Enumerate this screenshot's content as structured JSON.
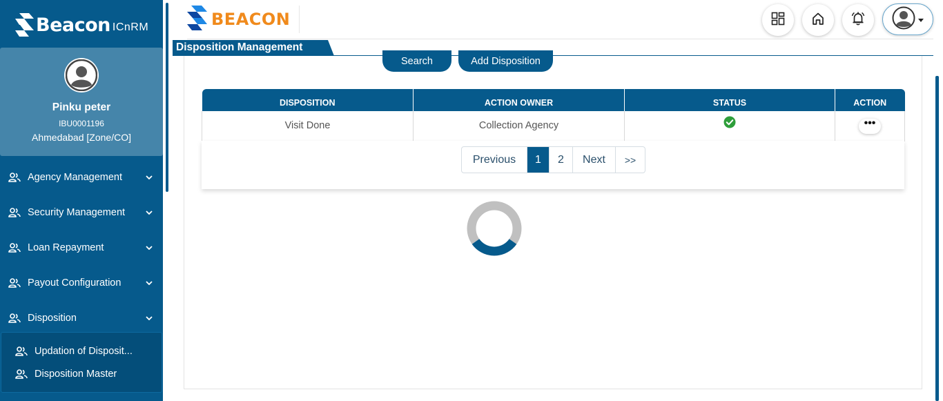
{
  "sidebar": {
    "brand_name": "Beacon",
    "brand_sub": "ICnRM",
    "user": {
      "name": "Pinku peter",
      "id": "IBU0001196",
      "location": "Ahmedabad [Zone/CO]"
    },
    "nav_items": [
      {
        "label": "Agency Management",
        "icon": "users-icon",
        "expandable": true
      },
      {
        "label": "Security Management",
        "icon": "users-icon",
        "expandable": true
      },
      {
        "label": "Loan Repayment",
        "icon": "users-icon",
        "expandable": true
      },
      {
        "label": "Payout Configuration",
        "icon": "users-icon",
        "expandable": true
      },
      {
        "label": "Disposition",
        "icon": "users-icon",
        "expandable": true,
        "expanded": true
      }
    ],
    "sub_items": [
      {
        "label": "Updation of Disposit..."
      },
      {
        "label": "Disposition Master"
      }
    ]
  },
  "header": {
    "logo_text": "BEACON",
    "icons": [
      "dashboard-icon",
      "home-icon",
      "bell-icon",
      "user-avatar-icon"
    ]
  },
  "page": {
    "title": "Disposition Management",
    "search_label": "Search",
    "add_label": "Add Disposition"
  },
  "table": {
    "columns": [
      "DISPOSITION",
      "ACTION OWNER",
      "STATUS",
      "ACTION"
    ],
    "rows": [
      {
        "disposition": "Visit Done",
        "action_owner": "Collection Agency",
        "status": "active",
        "action": "•••"
      }
    ]
  },
  "pagination": {
    "previous": "Previous",
    "pages": [
      "1",
      "2"
    ],
    "current": "1",
    "next": "Next",
    "last": ">>"
  },
  "colors": {
    "primary": "#065a8c",
    "profile_bg": "#4585aa",
    "logo_orange": "#f08a1c",
    "logo_blue": "#1e88e5",
    "status_green": "#2e9e3a",
    "spinner_gray": "#c0c0c0"
  }
}
